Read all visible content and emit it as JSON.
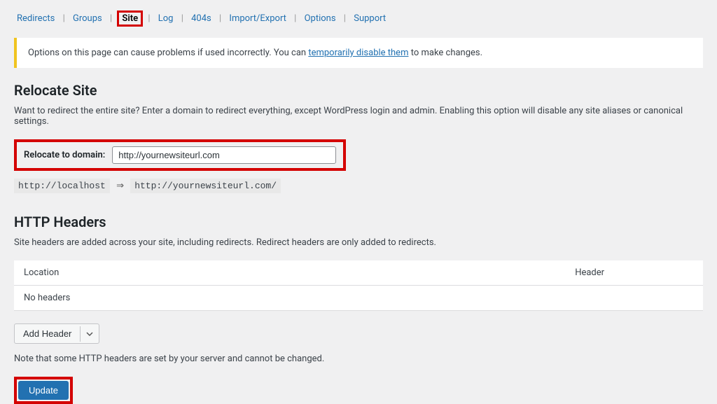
{
  "nav": {
    "items": [
      {
        "label": "Redirects",
        "active": false
      },
      {
        "label": "Groups",
        "active": false
      },
      {
        "label": "Site",
        "active": true
      },
      {
        "label": "Log",
        "active": false
      },
      {
        "label": "404s",
        "active": false
      },
      {
        "label": "Import/Export",
        "active": false
      },
      {
        "label": "Options",
        "active": false
      },
      {
        "label": "Support",
        "active": false
      }
    ]
  },
  "notice": {
    "prefix": "Options on this page can cause problems if used incorrectly. You can ",
    "link": "temporarily disable them",
    "suffix": " to make changes."
  },
  "relocate": {
    "title": "Relocate Site",
    "desc": "Want to redirect the entire site? Enter a domain to redirect everything, except WordPress login and admin. Enabling this option will disable any site aliases or canonical settings.",
    "label": "Relocate to domain:",
    "value": "http://yournewsiteurl.com",
    "from": "http://localhost",
    "arrow": "⇒",
    "to": "http://yournewsiteurl.com/"
  },
  "headers": {
    "title": "HTTP Headers",
    "desc": "Site headers are added across your site, including redirects. Redirect headers are only added to redirects.",
    "col_location": "Location",
    "col_header": "Header",
    "empty": "No headers",
    "add_label": "Add Header",
    "note": "Note that some HTTP headers are set by your server and cannot be changed."
  },
  "update": {
    "label": "Update"
  }
}
